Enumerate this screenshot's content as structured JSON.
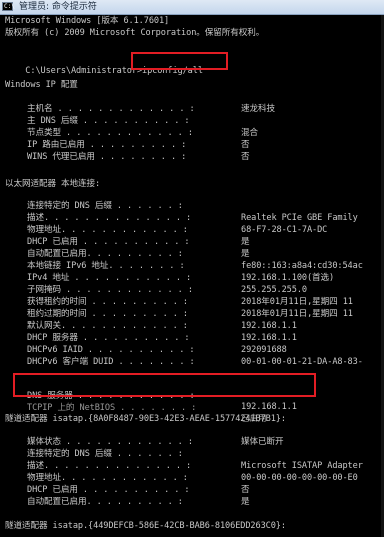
{
  "window": {
    "title": "管理员: 命令提示符",
    "icon": "console-icon"
  },
  "console": {
    "header": {
      "version": "Microsoft Windows [版本 6.1.7601]",
      "copyright": "版权所有 (c) 2009 Microsoft Corporation。保留所有权利。"
    },
    "prompt": {
      "path": "C:\\Users\\Administrator>",
      "command": "ipconfig/all"
    },
    "windows_ip": {
      "heading": "Windows IP 配置",
      "rows": [
        {
          "label": "主机名 . . . . . . . . . . . . . :",
          "value": "速龙科技"
        },
        {
          "label": "主 DNS 后缀 . . . . . . . . . . :",
          "value": ""
        },
        {
          "label": "节点类型 . . . . . . . . . . . . :",
          "value": "混合"
        },
        {
          "label": "IP 路由已启用 . . . . . . . . . :",
          "value": "否"
        },
        {
          "label": "WINS 代理已启用 . . . . . . . . :",
          "value": "否"
        }
      ]
    },
    "ethernet": {
      "heading": "以太网适配器 本地连接:",
      "rows": [
        {
          "label": "连接特定的 DNS 后缀 . . . . . . :",
          "value": ""
        },
        {
          "label": "描述. . . . . . . . . . . . . . :",
          "value": "Realtek PCIe GBE Family"
        },
        {
          "label": "物理地址. . . . . . . . . . . . :",
          "value": "68-F7-28-C1-7A-DC"
        },
        {
          "label": "DHCP 已启用 . . . . . . . . . . :",
          "value": "是"
        },
        {
          "label": "自动配置已启用. . . . . . . . . :",
          "value": "是"
        },
        {
          "label": "本地链接 IPv6 地址. . . . . . . :",
          "value": "fe80::163:a8a4:cd30:54ac"
        },
        {
          "label": "IPv4 地址 . . . . . . . . . . . :",
          "value": "192.168.1.100(首选)"
        },
        {
          "label": "子网掩码 . . . . . . . . . . . . :",
          "value": "255.255.255.0"
        },
        {
          "label": "获得租约的时间 . . . . . . . . . :",
          "value": "2018年01月11日,星期四 11"
        },
        {
          "label": "租约过期的时间 . . . . . . . . . :",
          "value": "2018年01月11日,星期四 11"
        },
        {
          "label": "默认网关. . . . . . . . . . . . :",
          "value": "192.168.1.1"
        },
        {
          "label": "DHCP 服务器 . . . . . . . . . . :",
          "value": "192.168.1.1"
        },
        {
          "label": "DHCPv6 IAID . . . . . . . . . . :",
          "value": "292091688"
        },
        {
          "label": "DHCPv6 客户端 DUID . . . . . . . :",
          "value": "00-01-00-01-21-DA-A8-83-"
        }
      ],
      "dns_row": {
        "label": "DNS 服务器 . . . . . . . . . . . :",
        "value": "192.168.1.1"
      },
      "netbios_row": {
        "label": "TCPIP 上的 NetBIOS . . . . . . . :",
        "value": "已启用"
      }
    },
    "tunnel1": {
      "heading": "隧道适配器 isatap.{8A0F8487-90E3-42E3-AEAE-15774241B7B1}:",
      "rows": [
        {
          "label": "媒体状态 . . . . . . . . . . . . :",
          "value": "媒体已断开"
        },
        {
          "label": "连接特定的 DNS 后缀 . . . . . . :",
          "value": ""
        },
        {
          "label": "描述. . . . . . . . . . . . . . :",
          "value": "Microsoft ISATAP Adapter"
        },
        {
          "label": "物理地址. . . . . . . . . . . . :",
          "value": "00-00-00-00-00-00-00-E0"
        },
        {
          "label": "DHCP 已启用 . . . . . . . . . . :",
          "value": "否"
        },
        {
          "label": "自动配置已启用. . . . . . . . . :",
          "value": "是"
        }
      ]
    },
    "tunnel2": {
      "heading": "隧道适配器 isatap.{449DEFCB-586E-42CB-BAB6-8106EDD263C0}:"
    }
  }
}
